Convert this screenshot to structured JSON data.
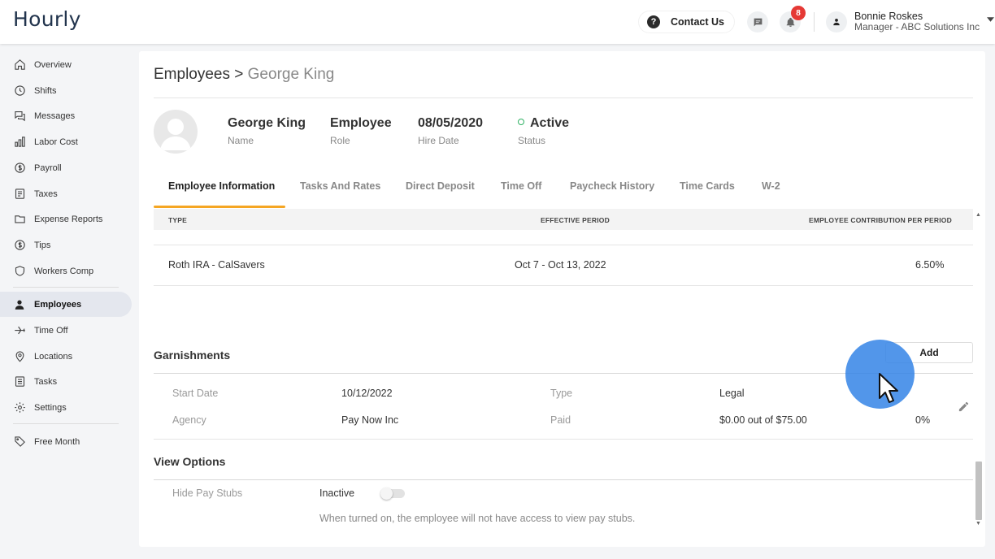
{
  "header": {
    "logo": "Hourly",
    "contact_label": "Contact Us",
    "notification_count": "8",
    "user_name": "Bonnie Roskes",
    "user_role": "Manager - ABC Solutions Inc"
  },
  "sidebar": {
    "items": [
      {
        "label": "Overview",
        "icon": "home-icon"
      },
      {
        "label": "Shifts",
        "icon": "clock-icon"
      },
      {
        "label": "Messages",
        "icon": "chat-icon"
      },
      {
        "label": "Labor Cost",
        "icon": "bar-chart-icon"
      },
      {
        "label": "Payroll",
        "icon": "dollar-circle-icon"
      },
      {
        "label": "Taxes",
        "icon": "document-icon"
      },
      {
        "label": "Expense Reports",
        "icon": "folder-icon"
      },
      {
        "label": "Tips",
        "icon": "dollar-circle-icon"
      },
      {
        "label": "Workers Comp",
        "icon": "shield-icon"
      },
      {
        "label": "Employees",
        "icon": "person-icon"
      },
      {
        "label": "Time Off",
        "icon": "plane-icon"
      },
      {
        "label": "Locations",
        "icon": "pin-icon"
      },
      {
        "label": "Tasks",
        "icon": "list-icon"
      },
      {
        "label": "Settings",
        "icon": "gear-icon"
      },
      {
        "label": "Free Month",
        "icon": "tag-icon"
      }
    ]
  },
  "breadcrumb": {
    "parent": "Employees",
    "separator": " > ",
    "current": "George King"
  },
  "employee": {
    "name": "George King",
    "name_label": "Name",
    "role": "Employee",
    "role_label": "Role",
    "hire_date": "08/05/2020",
    "hire_date_label": "Hire Date",
    "status": "Active",
    "status_label": "Status"
  },
  "tabs": [
    "Employee Information",
    "Tasks And Rates",
    "Direct Deposit",
    "Time Off",
    "Paycheck History",
    "Time Cards",
    "W-2"
  ],
  "retirement_table": {
    "headers": [
      "TYPE",
      "EFFECTIVE PERIOD",
      "EMPLOYEE CONTRIBUTION PER PERIOD"
    ],
    "rows": [
      {
        "type": "Roth IRA - CalSavers",
        "period": "Oct 7 - Oct 13, 2022",
        "contribution": "6.50%"
      }
    ]
  },
  "garnishments": {
    "title": "Garnishments",
    "add_label": "Add",
    "start_date_label": "Start Date",
    "start_date": "10/12/2022",
    "type_label": "Type",
    "type": "Legal",
    "agency_label": "Agency",
    "agency": "Pay Now Inc",
    "paid_label": "Paid",
    "paid": "$0.00 out of $75.00",
    "percent": "0%"
  },
  "view_options": {
    "title": "View Options",
    "hide_pay_stubs_label": "Hide Pay Stubs",
    "toggle_state": "Inactive",
    "help_text": "When turned on, the employee will not have access to view pay stubs."
  }
}
